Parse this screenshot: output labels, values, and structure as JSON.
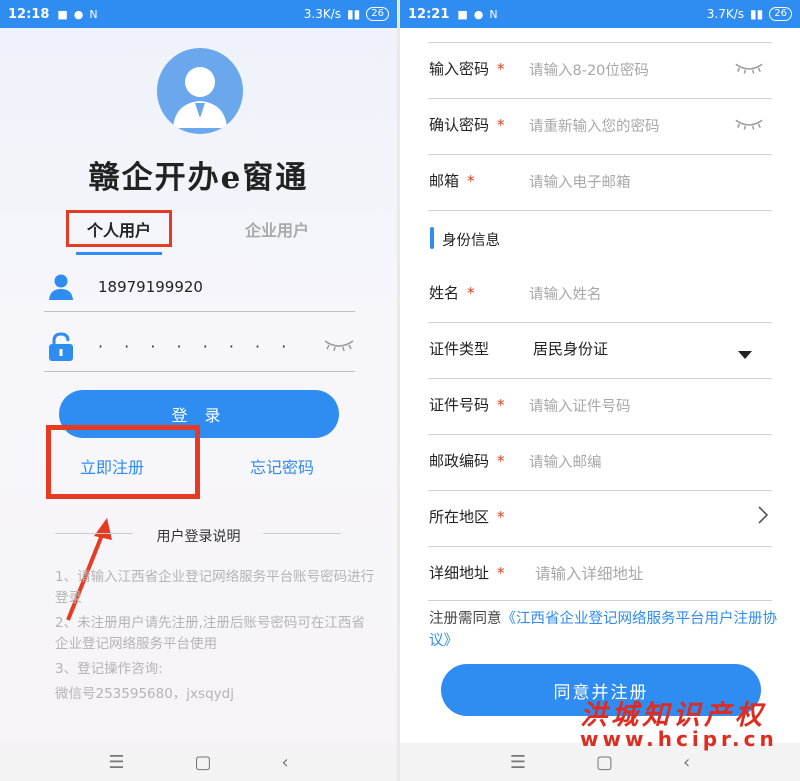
{
  "left": {
    "status": {
      "time": "12:18",
      "speed": "3.3K/s",
      "battery": "26"
    },
    "app_title": "赣企开办e窗通",
    "tabs": {
      "personal": "个人用户",
      "enterprise": "企业用户"
    },
    "phone_value": "18979199920",
    "password_mask": "· · · · · · · ·",
    "login_label": "登 录",
    "register_link": "立即注册",
    "forgot_link": "忘记密码",
    "section_title": "用户登录说明",
    "notes": [
      "1、请输入江西省企业登记网络服务平台账号密码进行登录",
      "2、未注册用户请先注册,注册后账号密码可在江西省企业登记网络服务平台使用",
      "3、登记操作咨询:",
      "微信号253595680，jxsqydj"
    ]
  },
  "right": {
    "status": {
      "time": "12:21",
      "speed": "3.7K/s",
      "battery": "26"
    },
    "rows": [
      {
        "label": "输入密码",
        "required": "*",
        "placeholder": "请输入8-20位密码"
      },
      {
        "label": "确认密码",
        "required": "*",
        "placeholder": "请重新输入您的密码"
      },
      {
        "label": "邮箱",
        "required": "*",
        "placeholder": "请输入电子邮箱"
      },
      {
        "label": "姓名",
        "required": "*",
        "placeholder": "请输入姓名"
      },
      {
        "label": "证件类型",
        "required": "",
        "value": "居民身份证"
      },
      {
        "label": "证件号码",
        "required": "*",
        "placeholder": "请输入证件号码"
      },
      {
        "label": "邮政编码",
        "required": "*",
        "placeholder": "请输入邮编"
      },
      {
        "label": "所在地区",
        "required": "*",
        "placeholder": ""
      },
      {
        "label": "详细地址",
        "required": "*",
        "placeholder": "请输入详细地址"
      }
    ],
    "section_identity": "身份信息",
    "agreement_prefix": "注册需同意",
    "agreement_link": "《江西省企业登记网络服务平台用户注册协议》",
    "agree_button": "同意并注册"
  },
  "watermark": {
    "cn": "洪城知识产权",
    "url": "www.hcipr.cn"
  },
  "colors": {
    "accent": "#2f8cf0",
    "highlight": "#e53b22"
  }
}
